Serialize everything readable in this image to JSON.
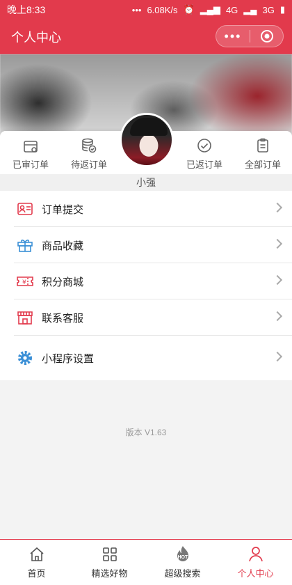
{
  "status": {
    "time": "晚上8:33",
    "speed": "6.08K/s",
    "network1": "4G",
    "network2": "3G"
  },
  "header": {
    "title": "个人中心",
    "capsule_dots": "•••"
  },
  "orders": [
    {
      "label": "已审订单",
      "icon": "calendar-icon"
    },
    {
      "label": "待返订单",
      "icon": "coins-icon"
    },
    {
      "label": "已返订单",
      "icon": "check-circle-icon"
    },
    {
      "label": "全部订单",
      "icon": "clipboard-icon"
    }
  ],
  "profile": {
    "username": "小强"
  },
  "menu": [
    {
      "label": "订单提交",
      "icon": "id-card-icon",
      "color": "#e23a4c"
    },
    {
      "label": "商品收藏",
      "icon": "gift-icon",
      "color": "#3a8fd6"
    },
    {
      "label": "积分商城",
      "icon": "ticket-icon",
      "color": "#e23a4c"
    },
    {
      "label": "联系客服",
      "icon": "shop-icon",
      "color": "#e23a4c"
    },
    {
      "label": "小程序设置",
      "icon": "gear-icon",
      "color": "#3a8fd6"
    }
  ],
  "version": "版本 V1.63",
  "tabs": [
    {
      "label": "首页",
      "icon": "home-icon"
    },
    {
      "label": "精选好物",
      "icon": "grid-icon"
    },
    {
      "label": "超级搜索",
      "icon": "hot-icon",
      "badge": "HOT"
    },
    {
      "label": "个人中心",
      "icon": "user-icon",
      "active": true
    }
  ],
  "colors": {
    "accent": "#e23a4c",
    "blue": "#3a8fd6"
  }
}
